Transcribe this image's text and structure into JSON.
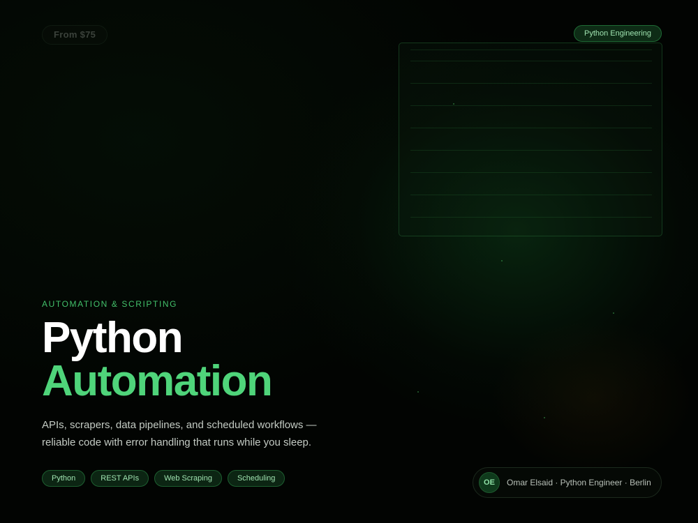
{
  "header": {
    "price_label": "From $75",
    "topic_badge": "Python Engineering"
  },
  "hero": {
    "eyebrow": "AUTOMATION & SCRIPTING",
    "title_line1": "Python",
    "title_line2": "Automation",
    "description": "APIs, scrapers, data pipelines, and scheduled workflows — reliable code with error handling that runs while you sleep."
  },
  "tags": [
    "Python",
    "REST APIs",
    "Web Scraping",
    "Scheduling"
  ],
  "author": {
    "initials": "OE",
    "byline": "Omar Elsaid · Python Engineer · Berlin"
  },
  "colors": {
    "accent": "#4fd47a",
    "background": "#020402",
    "badge_text": "#9fe3b0"
  }
}
